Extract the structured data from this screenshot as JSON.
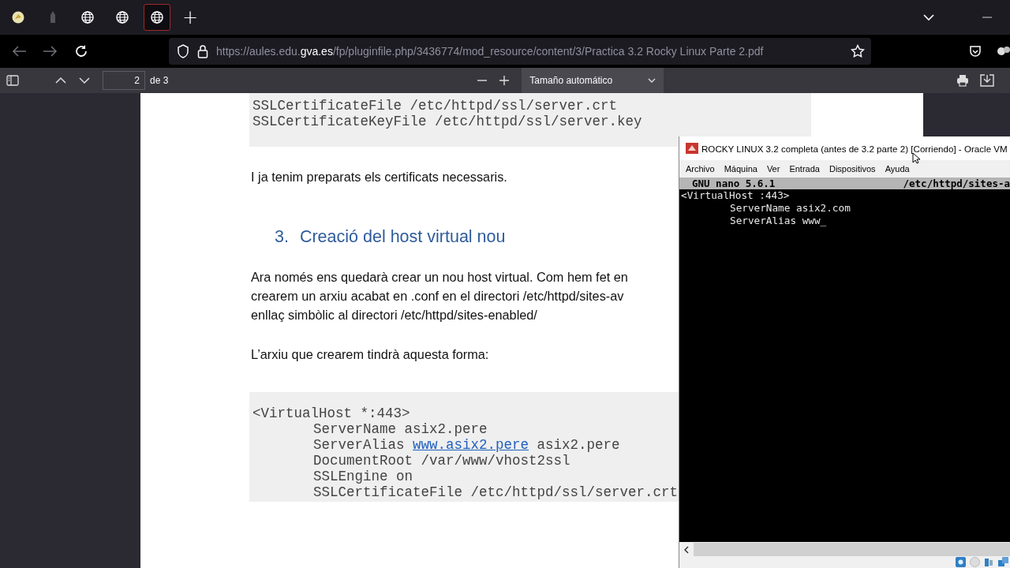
{
  "browser": {
    "tabs": [
      {
        "kind": "favicon",
        "selected": false
      },
      {
        "kind": "faded",
        "selected": false
      },
      {
        "kind": "globe",
        "selected": false
      },
      {
        "kind": "globe",
        "selected": false
      },
      {
        "kind": "globe",
        "selected": true
      }
    ],
    "new_tab": "+",
    "address": [
      {
        "kind": "dim",
        "text": "https://aules.edu."
      },
      {
        "kind": "bright",
        "text": "gva.es"
      },
      {
        "kind": "dim",
        "text": "/fp/pluginfile.php/3436774/mod_resource/content/3/Practica 3.2 Rocky Linux Parte 2.pdf"
      }
    ]
  },
  "pdf_toolbar": {
    "page": "2",
    "page_count": "de 3",
    "zoom": "Tamaño automático"
  },
  "document": {
    "blocks": [
      {
        "kind": "code",
        "lines": [
          {
            "text": "SSLCertificateFile /etc/httpd/ssl/server.crt"
          },
          {
            "text": "SSLCertificateKeyFile /etc/httpd/ssl/server.key"
          }
        ]
      },
      {
        "kind": "para",
        "lines": [
          "I ja tenim preparats els certificats necessaris."
        ]
      },
      {
        "kind": "heading",
        "number": "3.",
        "text": "Creació del host virtual nou"
      },
      {
        "kind": "para",
        "lines": [
          "Ara només ens quedarà crear un nou host virtual. Com hem fet en",
          "crearem un arxiu acabat en .conf en el directori /etc/httpd/sites-av",
          "enllaç simbòlic al directori /etc/httpd/sites-enabled/"
        ]
      },
      {
        "kind": "para",
        "lines": [
          "L’arxiu que crearem tindrà aquesta forma:"
        ]
      },
      {
        "kind": "code",
        "lines": [
          {
            "text": "<VirtualHost *:443>",
            "children": [
              {
                "text": "ServerName asix2.pere"
              },
              {
                "text": "ServerAlias ",
                "link": "www.asix2.pere",
                "after": " asix2.pere"
              },
              {
                "text": "DocumentRoot /var/www/vhost2ssl"
              },
              {
                "text": "SSLEngine on"
              },
              {
                "text": "SSLCertificateFile /etc/httpd/ssl/server.crt"
              }
            ]
          }
        ]
      }
    ]
  },
  "vm_window": {
    "title": "ROCKY LINUX 3.2 completa (antes de 3.2 parte 2) [Corriendo] - Oracle VM",
    "menu": [
      "Archivo",
      "Máquina",
      "Ver",
      "Entrada",
      "Dispositivos",
      "Ayuda"
    ],
    "nano_header": {
      "version": "GNU nano 5.6.1",
      "file": "/etc/httpd/sites-a"
    },
    "terminal": [
      {
        "text": "<VirtualHost :443>",
        "children": [
          {
            "text": "ServerName asix2.com"
          },
          {
            "text": "ServerAlias www_"
          }
        ]
      }
    ]
  }
}
